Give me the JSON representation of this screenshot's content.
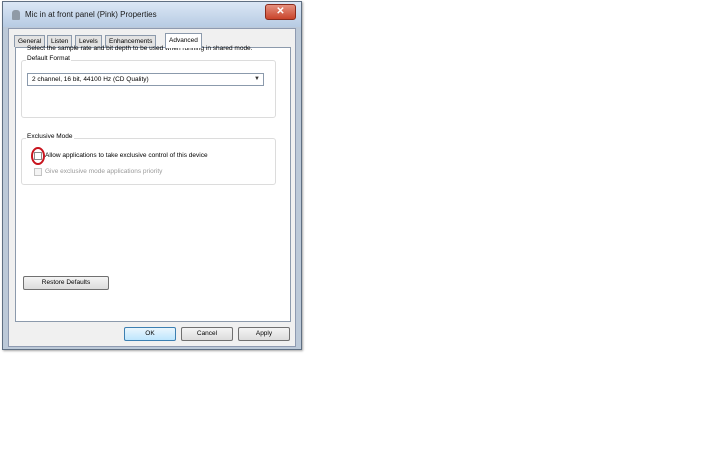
{
  "window": {
    "title": "Mic in at front panel (Pink) Properties",
    "close_label": "✕"
  },
  "tabs": [
    {
      "label": "General"
    },
    {
      "label": "Listen"
    },
    {
      "label": "Levels"
    },
    {
      "label": "Enhancements"
    },
    {
      "label": "Advanced"
    }
  ],
  "active_tab": "Advanced",
  "default_format": {
    "group_label": "Default Format",
    "description": "Select the sample rate and bit depth to be used when running in shared mode.",
    "selected_value": "2 channel, 16 bit, 44100 Hz (CD Quality)"
  },
  "exclusive_mode": {
    "group_label": "Exclusive Mode",
    "allow_exclusive_label": "Allow applications to take exclusive control of this device",
    "allow_exclusive_checked": false,
    "priority_label": "Give exclusive mode applications priority",
    "priority_checked": false,
    "priority_enabled": false
  },
  "restore_defaults_label": "Restore Defaults",
  "dialog_buttons": {
    "ok_label": "OK",
    "cancel_label": "Cancel",
    "apply_label": "Apply"
  },
  "colors": {
    "highlight_ring": "#c8141e",
    "default_button_border": "#3c7fb1"
  }
}
